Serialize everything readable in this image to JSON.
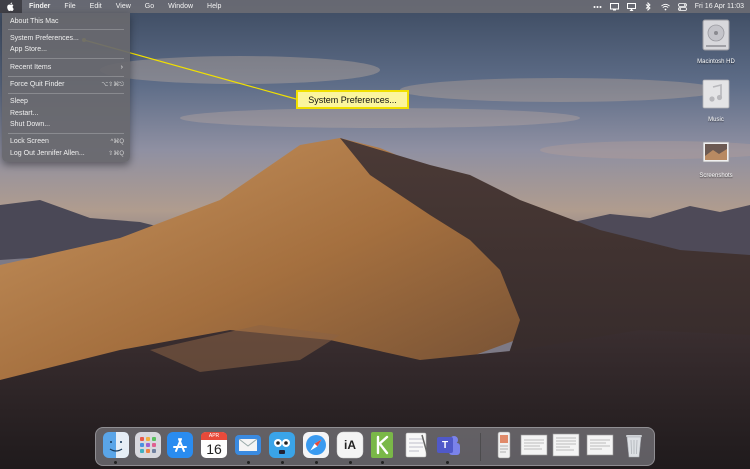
{
  "menubar": {
    "apple_icon": "apple-logo-icon",
    "items": [
      "Finder",
      "File",
      "Edit",
      "View",
      "Go",
      "Window",
      "Help"
    ],
    "status_icons": [
      "more-dots-icon",
      "display-icon",
      "cast-icon",
      "bluetooth-icon",
      "wifi-icon",
      "control-center-icon"
    ],
    "clock": "Fri 16 Apr  11:03"
  },
  "apple_menu": {
    "about": "About This Mac",
    "system_preferences": "System Preferences...",
    "app_store": "App Store...",
    "recent_items": "Recent Items",
    "force_quit": "Force Quit Finder",
    "force_quit_shortcut": "⌥⇧⌘⎋",
    "sleep": "Sleep",
    "restart": "Restart...",
    "shut_down": "Shut Down...",
    "lock_screen": "Lock Screen",
    "lock_screen_shortcut": "^⌘Q",
    "log_out": "Log Out Jennifer Allen...",
    "log_out_shortcut": "⇧⌘Q"
  },
  "callout": {
    "label": "System Preferences..."
  },
  "desktop_icons": {
    "hd": "Macintosh HD",
    "music": "Music",
    "screenshots": "Screenshots"
  },
  "dock": {
    "calendar_month": "APR",
    "calendar_day": "16",
    "ia_writer_label": "iA",
    "teams_label": "T",
    "apps": [
      "finder-icon",
      "launchpad-icon",
      "app-store-icon",
      "calendar-icon",
      "mail-icon",
      "tweetbot-icon",
      "safari-icon",
      "ia-writer-icon",
      "scrivener-icon",
      "textedit-icon",
      "teams-icon"
    ],
    "stack_items": [
      "document-thumbnail-icon",
      "document-thumbnail-icon",
      "document-thumbnail-icon",
      "document-thumbnail-icon",
      "document-thumbnail-icon",
      "trash-icon"
    ]
  },
  "colors": {
    "callout_fill": "#fbf59e",
    "callout_border": "#f1e000",
    "menu_bg": "#68686e"
  }
}
